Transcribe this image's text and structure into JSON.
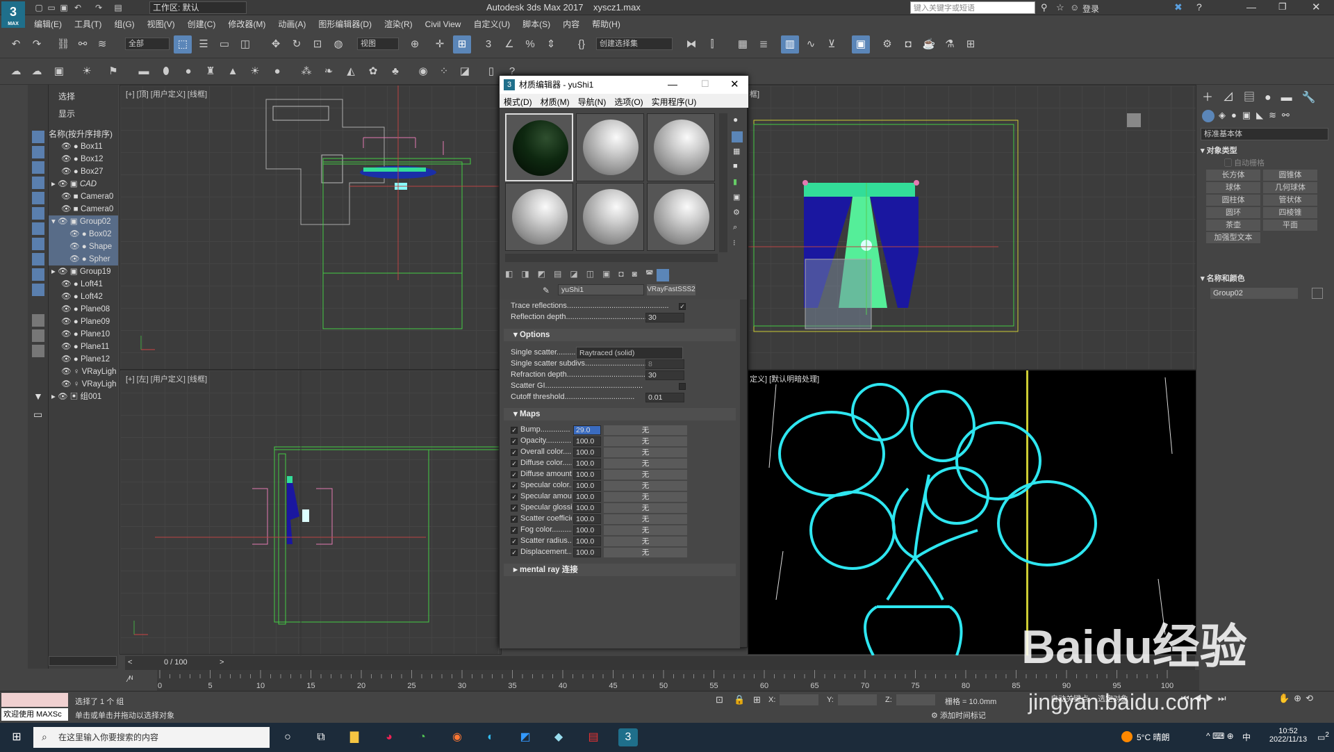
{
  "titlebar": {
    "workspace": "工作区: 默认",
    "title": "Autodesk 3ds Max 2017",
    "file": "xyscz1.max",
    "search_placeholder": "键入关键字或短语",
    "login": "登录"
  },
  "menu": [
    "编辑(E)",
    "工具(T)",
    "组(G)",
    "视图(V)",
    "创建(C)",
    "修改器(M)",
    "动画(A)",
    "图形编辑器(D)",
    "渲染(R)",
    "Civil View",
    "自定义(U)",
    "脚本(S)",
    "内容",
    "帮助(H)"
  ],
  "toolbar": {
    "filter": "全部",
    "refcoord": "视图",
    "selset": "创建选择集"
  },
  "scene": {
    "tab_select": "选择",
    "tab_display": "显示",
    "header": "名称(按升序排序)",
    "items": [
      "Box11",
      "Box12",
      "Box27",
      "CAD",
      "Camera0",
      "Camera0",
      "Group02",
      "Box02",
      "Shape",
      "Spher",
      "Group19",
      "Loft41",
      "Loft42",
      "Plane08",
      "Plane09",
      "Plane10",
      "Plane11",
      "Plane12",
      "VRayLigh",
      "VRayLigh",
      "组001"
    ]
  },
  "viewports": {
    "top": "[+] [顶] [用户定义] [线框]",
    "left": "[+] [左] [用户定义] [线框]",
    "front_suffix": "框]",
    "persp": "定义] [默认明暗处理]"
  },
  "matedit": {
    "title": "材质编辑器 - yuShi1",
    "menu": [
      "模式(D)",
      "材质(M)",
      "导航(N)",
      "选项(O)",
      "实用程序(U)"
    ],
    "mat_name": "yuShi1",
    "mat_type": "VRayFastSSS2",
    "trace_refl": "Trace reflections",
    "refl_depth_label": "Reflection depth",
    "refl_depth": "30",
    "options": "Options",
    "single_scatter": "Single scatter",
    "single_scatter_val": "Raytraced (solid)",
    "ss_subdivs": "Single scatter subdivs",
    "ss_subdivs_val": "8",
    "refr_depth": "Refraction depth",
    "refr_depth_val": "30",
    "scatter_gi": "Scatter GI",
    "cutoff": "Cutoff threshold",
    "cutoff_val": "0.01",
    "maps": "Maps",
    "none": "无",
    "map_rows": [
      {
        "n": "Bump",
        "v": "29.0"
      },
      {
        "n": "Opacity",
        "v": "100.0"
      },
      {
        "n": "Overall color",
        "v": "100.0"
      },
      {
        "n": "Diffuse color",
        "v": "100.0"
      },
      {
        "n": "Diffuse amount",
        "v": "100.0"
      },
      {
        "n": "Specular color",
        "v": "100.0"
      },
      {
        "n": "Specular amount",
        "v": "100.0"
      },
      {
        "n": "Specular glossiness",
        "v": "100.0"
      },
      {
        "n": "Scatter coefficient",
        "v": "100.0"
      },
      {
        "n": "Fog color",
        "v": "100.0"
      },
      {
        "n": "Scatter radius",
        "v": "100.0"
      },
      {
        "n": "Displacement",
        "v": "100.0"
      }
    ],
    "mental": "mental ray 连接"
  },
  "cmd": {
    "dropdown": "标准基本体",
    "obj_type": "对象类型",
    "autogrid": "自动栅格",
    "buttons": [
      "长方体",
      "圆锥体",
      "球体",
      "几何球体",
      "圆柱体",
      "管状体",
      "圆环",
      "四棱锥",
      "茶壶",
      "平面",
      "加强型文本"
    ],
    "namecolor": "名称和颜色",
    "objname": "Group02"
  },
  "time": {
    "frame": "0 / 100",
    "ticks": [
      "0",
      "5",
      "10",
      "15",
      "20",
      "25",
      "30",
      "35",
      "40",
      "45",
      "50",
      "55",
      "60",
      "65",
      "70",
      "75",
      "80",
      "85",
      "90",
      "95",
      "100"
    ]
  },
  "status": {
    "welcome": "欢迎使用 MAXSc",
    "sel": "选择了 1 个 组",
    "hint": "单击或单击并拖动以选择对象",
    "x": "X:",
    "y": "Y:",
    "z": "Z:",
    "grid": "栅格 = 10.0mm",
    "autokey": "自动关键点",
    "setkey": "选定对象",
    "addtime": "添加时间标记"
  },
  "taskbar": {
    "search": "在这里输入你要搜索的内容",
    "weather": "5°C 晴朗",
    "ime": "中",
    "time": "10:52",
    "date": "2022/11/13",
    "notif": "2"
  },
  "watermark": {
    "brand": "Baidu经验",
    "url": "jingyan.baidu.com"
  }
}
